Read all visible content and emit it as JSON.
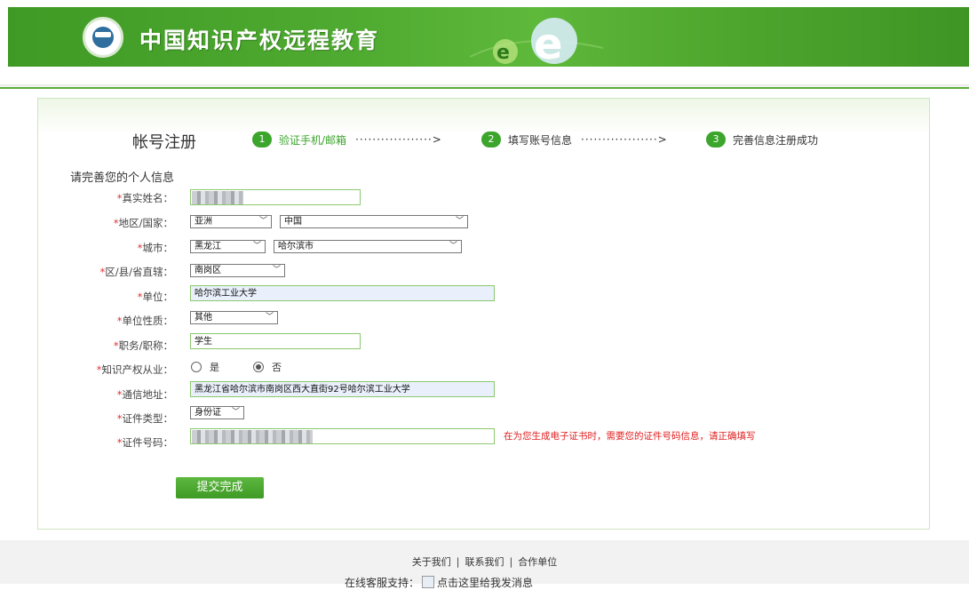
{
  "header": {
    "title": "中国知识产权远程教育"
  },
  "registration": {
    "title": "帐号注册",
    "steps": [
      {
        "num": "1",
        "label": "验证手机/邮箱",
        "dots": "··················>"
      },
      {
        "num": "2",
        "label": "填写账号信息",
        "dots": "··················>"
      },
      {
        "num": "3",
        "label": "完善信息注册成功"
      }
    ],
    "section_title": "请完善您的个人信息"
  },
  "form": {
    "name_label": "真实姓名：",
    "region_label": "地区/国家：",
    "region_continent": "亚洲",
    "region_country": "中国",
    "city_label": "城市：",
    "province": "黑龙江",
    "city": "哈尔滨市",
    "district_label": "区/县/省直辖：",
    "district": "南岗区",
    "unit_label": "单位：",
    "unit": "哈尔滨工业大学",
    "unit_type_label": "单位性质：",
    "unit_type": "其他",
    "position_label": "职务/职称：",
    "position": "学生",
    "ip_label": "知识产权从业：",
    "ip_yes": "是",
    "ip_no": "否",
    "address_label": "通信地址：",
    "address": "黑龙江省哈尔滨市南岗区西大直街92号哈尔滨工业大学",
    "id_type_label": "证件类型：",
    "id_type": "身份证",
    "id_number_label": "证件号码：",
    "id_warning": "在为您生成电子证书时，需要您的证件号码信息，请正确填写",
    "required_mark": "*",
    "submit": "提交完成"
  },
  "footer": {
    "links": [
      "关于我们",
      "联系我们",
      "合作单位"
    ],
    "separator": "|",
    "support_label": "在线客服支持：",
    "support_link": "点击这里给我发消息"
  },
  "colors": {
    "brand_green": "#4eaa30",
    "warning_red": "#e02020"
  }
}
